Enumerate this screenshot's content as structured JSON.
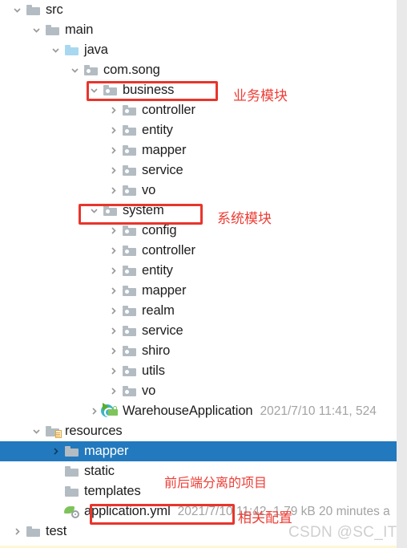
{
  "window": {
    "kind": "ide-project-tree",
    "watermark": "CSDN @SC_IT",
    "selection_color": "#2279bd",
    "annotation_color": "#e8352c"
  },
  "tree": {
    "rows": [
      {
        "label": "src",
        "indent": 1,
        "arrow": "expanded",
        "icon": "folder-icon",
        "meta": ""
      },
      {
        "label": "main",
        "indent": 2,
        "arrow": "expanded",
        "icon": "folder-icon",
        "meta": ""
      },
      {
        "label": "java",
        "indent": 3,
        "arrow": "expanded",
        "icon": "source-root-folder-icon",
        "meta": ""
      },
      {
        "label": "com.song",
        "indent": 4,
        "arrow": "expanded",
        "icon": "package-folder-icon",
        "meta": ""
      },
      {
        "label": "business",
        "indent": 5,
        "arrow": "expanded",
        "icon": "package-folder-icon",
        "meta": ""
      },
      {
        "label": "controller",
        "indent": 6,
        "arrow": "collapsed",
        "icon": "package-folder-icon",
        "meta": ""
      },
      {
        "label": "entity",
        "indent": 6,
        "arrow": "collapsed",
        "icon": "package-folder-icon",
        "meta": ""
      },
      {
        "label": "mapper",
        "indent": 6,
        "arrow": "collapsed",
        "icon": "package-folder-icon",
        "meta": ""
      },
      {
        "label": "service",
        "indent": 6,
        "arrow": "collapsed",
        "icon": "package-folder-icon",
        "meta": ""
      },
      {
        "label": "vo",
        "indent": 6,
        "arrow": "collapsed",
        "icon": "package-folder-icon",
        "meta": ""
      },
      {
        "label": "system",
        "indent": 5,
        "arrow": "expanded",
        "icon": "package-folder-icon",
        "meta": ""
      },
      {
        "label": "config",
        "indent": 6,
        "arrow": "collapsed",
        "icon": "package-folder-icon",
        "meta": ""
      },
      {
        "label": "controller",
        "indent": 6,
        "arrow": "collapsed",
        "icon": "package-folder-icon",
        "meta": ""
      },
      {
        "label": "entity",
        "indent": 6,
        "arrow": "collapsed",
        "icon": "package-folder-icon",
        "meta": ""
      },
      {
        "label": "mapper",
        "indent": 6,
        "arrow": "collapsed",
        "icon": "package-folder-icon",
        "meta": ""
      },
      {
        "label": "realm",
        "indent": 6,
        "arrow": "collapsed",
        "icon": "package-folder-icon",
        "meta": ""
      },
      {
        "label": "service",
        "indent": 6,
        "arrow": "collapsed",
        "icon": "package-folder-icon",
        "meta": ""
      },
      {
        "label": "shiro",
        "indent": 6,
        "arrow": "collapsed",
        "icon": "package-folder-icon",
        "meta": ""
      },
      {
        "label": "utils",
        "indent": 6,
        "arrow": "collapsed",
        "icon": "package-folder-icon",
        "meta": ""
      },
      {
        "label": "vo",
        "indent": 6,
        "arrow": "collapsed",
        "icon": "package-folder-icon",
        "meta": ""
      },
      {
        "label": "WarehouseApplication",
        "indent": 5,
        "arrow": "collapsed",
        "icon": "spring-boot-class-icon",
        "meta": "2021/7/10 11:41, 524"
      },
      {
        "label": "resources",
        "indent": 2,
        "arrow": "expanded",
        "icon": "resources-root-folder-icon",
        "meta": ""
      },
      {
        "label": "mapper",
        "indent": 3,
        "arrow": "collapsed",
        "icon": "folder-icon",
        "meta": "",
        "selected": true
      },
      {
        "label": "static",
        "indent": 3,
        "arrow": "none",
        "icon": "folder-icon",
        "meta": ""
      },
      {
        "label": "templates",
        "indent": 3,
        "arrow": "none",
        "icon": "folder-icon",
        "meta": ""
      },
      {
        "label": "application.yml",
        "indent": 3,
        "arrow": "none",
        "icon": "yaml-config-icon",
        "meta": "2021/7/10 11:42, 1.79 kB 20 minutes a"
      },
      {
        "label": "test",
        "indent": 1,
        "arrow": "collapsed",
        "icon": "folder-icon",
        "meta": ""
      }
    ]
  },
  "annotations": {
    "business_label": "业务模块",
    "system_label": "系统模块",
    "resources_label": "前后端分离的项目",
    "yml_label": "相关配置"
  }
}
